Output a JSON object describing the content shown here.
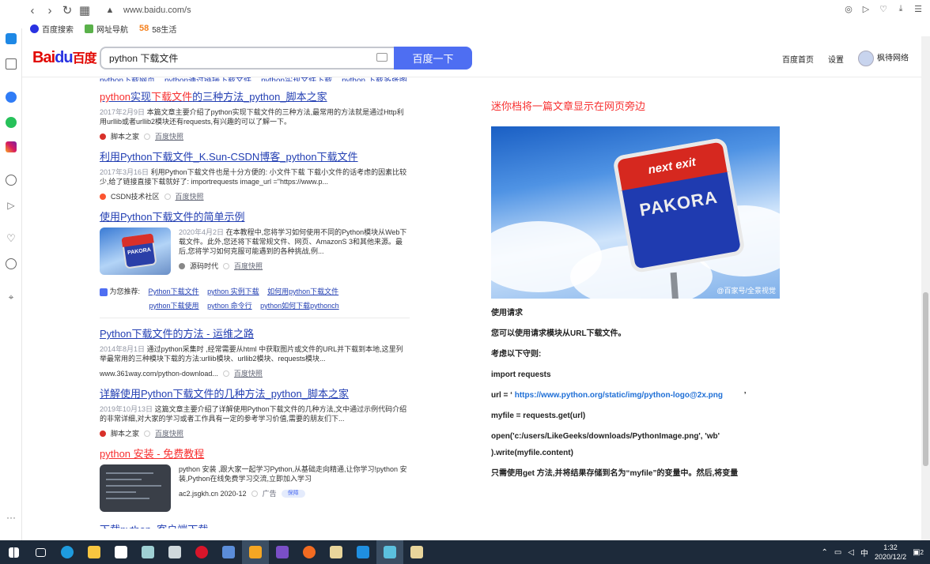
{
  "browser": {
    "url": "www.baidu.com/s",
    "bookmarks": [
      {
        "label": "百度搜索",
        "icon": "baidu-paw-icon"
      },
      {
        "label": "网址导航",
        "icon": "nav-icon"
      },
      {
        "label": "58生活",
        "icon": "58-icon",
        "prefix": "58"
      }
    ]
  },
  "header": {
    "logo_text": "Bai",
    "logo_paw": "du",
    "logo_cn": "百度",
    "search_value": "python 下载文件",
    "search_button": "百度一下",
    "home_link": "百度首页",
    "settings_link": "设置",
    "username": "枫待网络"
  },
  "related_top": [
    "python下载网页",
    "python通过链接下载文件",
    "python实现文件下载",
    "python 下载多张图"
  ],
  "results": [
    {
      "title_em": "python",
      "title_parts": [
        "实现",
        "下载文件",
        "的三种方法_python_脚本之家"
      ],
      "date": "2017年2月9日",
      "abstract": "本篇文章主要介绍了python实现下载文件的三种方法,最常用的方法就是通过Http利用urllib或者urllib2模块还有requests,有兴趣的可以了解一下。",
      "source": "脚本之家",
      "cache": "百度快照"
    },
    {
      "title": "利用Python下载文件_K.Sun-CSDN博客_python下载文件",
      "date": "2017年3月16日",
      "abstract": "利用Python下载文件也是十分方便的: 小文件下载 下载小文件的话考虑的因素比较少,给了链接直接下载就好了: importrequests image_url =\"https://www.p...",
      "source": "CSDN技术社区",
      "cache": "百度快照"
    },
    {
      "title": "使用Python下载文件的简单示例",
      "date": "2020年4月2日",
      "abstract": "在本教程中,您将学习如何使用不同的Python模块从Web下载文件。此外,您还将下载常规文件、网页、AmazonS 3和其他来源。最后,您将学习如何克服可能遇到的各种挑战,例...",
      "source": "源码时代",
      "cache": "百度快照"
    }
  ],
  "recommendations": {
    "label": "为您推荐:",
    "items": [
      "Python下载文件",
      "python 实例下载",
      "如何用python下载文件",
      "python下载使用",
      "python 命令行",
      "python如何下载pythonch"
    ]
  },
  "results2": [
    {
      "title": "Python下载文件的方法 - 运维之路",
      "date": "2014年8月1日",
      "abstract": "通过python采集时 ,经常需要从html 中获取图片或文件的URL并下载到本地,这里列举最常用的三种模块下载的方法:urllib模块、urllib2模块、requests模块...",
      "source": "www.361way.com/python-download...",
      "cache": "百度快照"
    },
    {
      "title": "详解使用Python下载文件的几种方法_python_脚本之家",
      "date": "2019年10月13日",
      "abstract": "这篇文章主要介绍了详解使用Python下载文件的几种方法,文中通过示例代码介绍的非常详细,对大家的学习或者工作具有一定的参考学习价值,需要的朋友们下...",
      "source": "脚本之家",
      "cache": "百度快照"
    }
  ],
  "ad": {
    "title": "python 安装 - 免费教程",
    "abstract": "python 安装 ,跟大家一起学习Python,从基础走向精通,让你学习!python 安装,Python在线免费学习交流,立即加入学习",
    "source": "ac2.jsgkh.cn 2020-12",
    "ad_label": "广告",
    "verified": "保障"
  },
  "bottom_cut": "下载python_客户端下载",
  "right": {
    "heading": "迷你档将一篇文章显示在网页旁边",
    "image_sign_top": "next exit",
    "image_sign_main": "PAKORA",
    "image_watermark": "@百家号/全景视觉",
    "lines": [
      "使用请求",
      "您可以使用请求模块从URL下载文件。",
      "考虑以下守则:",
      "import requests"
    ],
    "url_prefix": "url = ‘",
    "url_link": "https://www.python.org/static/img/python-logo@2x.png",
    "url_suffix": "’",
    "line_get": "myfile = requests.get(url)",
    "line_open1": "open('c:/users/LikeGeeks/downloads/PythonImage.png', 'wb'",
    "line_open2": ").write(myfile.content)",
    "line_last": "只需使用get 方法,并将结果存储到名为“myfile”的变量中。然后,将变量"
  },
  "taskbar": {
    "time": "1:32",
    "date": "2020/12/2",
    "ime": "中",
    "notif": "2"
  },
  "colors": {
    "link": "#2440b3",
    "highlight": "#f73131",
    "brand_blue": "#4e6ef2",
    "taskbar": "#1d2a3a"
  }
}
